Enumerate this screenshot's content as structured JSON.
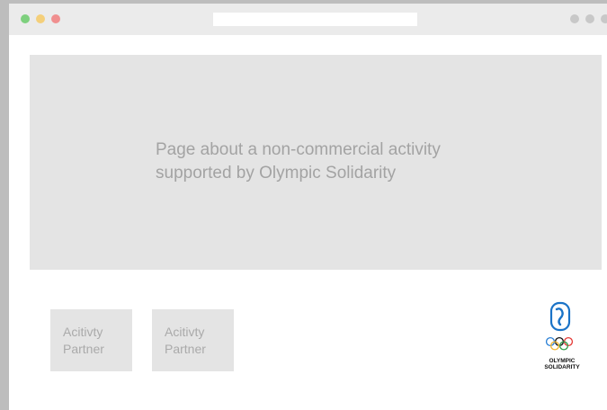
{
  "browser": {
    "window_controls": [
      "close",
      "minimize",
      "maximize"
    ],
    "address_value": "",
    "colors": {
      "dot_green": "#7ed07e",
      "dot_yellow": "#f4cf7a",
      "dot_red": "#f08f8f"
    }
  },
  "hero": {
    "line1": "Page about a non-commercial activity",
    "line2": "supported by Olympic Solidarity"
  },
  "partners": [
    {
      "line1": "Acitivty",
      "line2": "Partner"
    },
    {
      "line1": "Acitivty",
      "line2": "Partner"
    }
  ],
  "logo": {
    "icon": "olympic-solidarity-logo-icon",
    "line1": "OLYMPIC",
    "line2": "SOLIDARITY",
    "accent_color": "#1a73c7"
  }
}
